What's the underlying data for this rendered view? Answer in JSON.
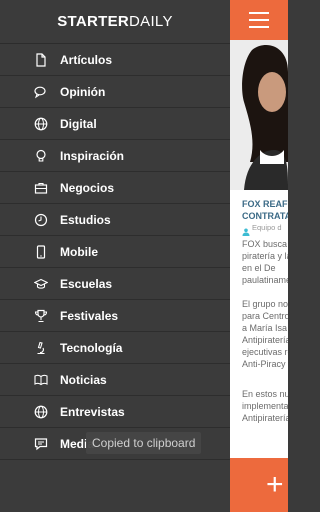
{
  "drawer": {
    "logo_bold": "STARTER",
    "logo_light": "DAILY",
    "items": [
      {
        "label": "Artículos",
        "icon": "document-icon"
      },
      {
        "label": "Opinión",
        "icon": "speech-bubbles-icon"
      },
      {
        "label": "Digital",
        "icon": "globe-icon"
      },
      {
        "label": "Inspiración",
        "icon": "lightbulb-icon"
      },
      {
        "label": "Negocios",
        "icon": "briefcase-icon"
      },
      {
        "label": "Estudios",
        "icon": "clock-icon"
      },
      {
        "label": "Mobile",
        "icon": "phone-icon"
      },
      {
        "label": "Escuelas",
        "icon": "graduation-cap-icon"
      },
      {
        "label": "Festivales",
        "icon": "trophy-icon"
      },
      {
        "label": "Tecnología",
        "icon": "microscope-icon"
      },
      {
        "label": "Noticias",
        "icon": "book-icon"
      },
      {
        "label": "Entrevistas",
        "icon": "globe-icon"
      },
      {
        "label": "Media",
        "icon": "chat-icon"
      }
    ]
  },
  "toast": "Copied to clipboard",
  "article": {
    "headline_line1": "FOX REAFIR",
    "headline_line2": "CONTRATAC",
    "author": "Equipo d",
    "paragraphs": [
      [
        "FOX busca r",
        "piratería y la",
        "en el De",
        "paulatiname"
      ],
      [
        "El grupo no",
        "para Centro",
        "a María Isa",
        "Antipiratería",
        "ejecutivas re",
        "Anti-Piracy C"
      ],
      [
        "En estos nu",
        "implementac",
        "Antipiratería"
      ]
    ]
  },
  "colors": {
    "accent": "#ed6a3d",
    "drawer_bg": "#3b3b3b",
    "headline": "#3b6a86"
  }
}
